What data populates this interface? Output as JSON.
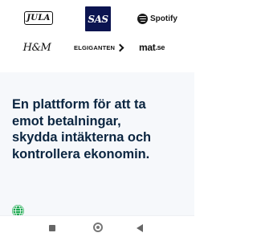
{
  "logos": {
    "jula": "JULA",
    "sas": "SAS",
    "spotify": "Spotify",
    "hm": "H&M",
    "elgiganten": "ELGIGANTEN",
    "matse_main": "mat",
    "matse_suffix": ".se"
  },
  "hero": {
    "line1": "En plattform för att ta",
    "line2": "emot betalningar,",
    "line3": "skydda intäkterna och",
    "line4": "kontrollera ekonomin."
  },
  "colors": {
    "headline": "#0a2540",
    "hero_background": "#f6f8fb",
    "sas_blue": "#0b1450",
    "globe_green": "#1aa84f"
  },
  "icons": {
    "globe": "globe-icon",
    "recent_apps": "recent-apps-icon",
    "home": "home-icon",
    "back": "back-icon"
  }
}
